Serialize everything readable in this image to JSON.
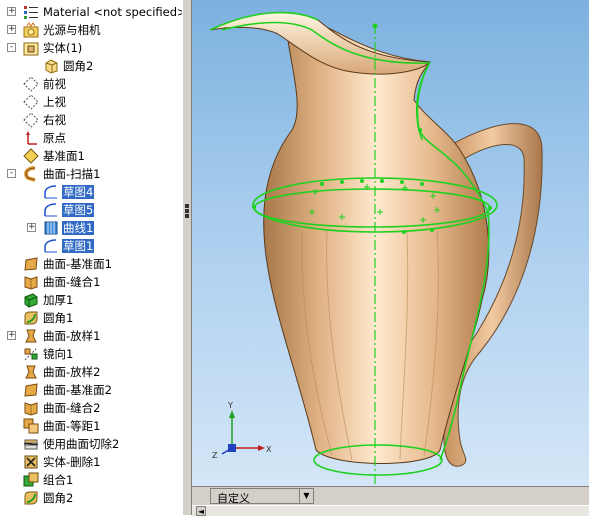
{
  "tree": {
    "items": [
      {
        "label": "Material <not specified>",
        "icon": "material-icon",
        "expander": "+"
      },
      {
        "label": "光源与相机",
        "icon": "lights-camera-icon",
        "expander": "+"
      },
      {
        "label": "实体(1)",
        "icon": "solid-bodies-folder-icon",
        "expander": "-"
      },
      {
        "label": "圆角2",
        "icon": "solid-body-icon"
      },
      {
        "label": "前视",
        "icon": "plane-icon"
      },
      {
        "label": "上视",
        "icon": "plane-icon"
      },
      {
        "label": "右视",
        "icon": "plane-icon"
      },
      {
        "label": "原点",
        "icon": "origin-icon"
      },
      {
        "label": "基准面1",
        "icon": "reference-plane-icon"
      },
      {
        "label": "曲面-扫描1",
        "icon": "surface-sweep-icon",
        "expander": "-"
      },
      {
        "label": "草图4",
        "icon": "sketch-icon",
        "selected": true
      },
      {
        "label": "草图5",
        "icon": "sketch-icon",
        "selected": true
      },
      {
        "label": "曲线1",
        "icon": "curve-icon",
        "selected": true,
        "expander": "+"
      },
      {
        "label": "草图1",
        "icon": "sketch-icon",
        "selected": true
      },
      {
        "label": "曲面-基准面1",
        "icon": "planar-surface-icon"
      },
      {
        "label": "曲面-缝合1",
        "icon": "knit-surface-icon"
      },
      {
        "label": "加厚1",
        "icon": "thicken-icon"
      },
      {
        "label": "圆角1",
        "icon": "fillet-icon"
      },
      {
        "label": "曲面-放样1",
        "icon": "surface-loft-icon",
        "expander": "+"
      },
      {
        "label": "镜向1",
        "icon": "mirror-icon"
      },
      {
        "label": "曲面-放样2",
        "icon": "surface-loft-icon"
      },
      {
        "label": "曲面-基准面2",
        "icon": "planar-surface-icon"
      },
      {
        "label": "曲面-缝合2",
        "icon": "knit-surface-icon"
      },
      {
        "label": "曲面-等距1",
        "icon": "offset-surface-icon"
      },
      {
        "label": "使用曲面切除2",
        "icon": "surface-cut-icon"
      },
      {
        "label": "实体-删除1",
        "icon": "delete-body-icon"
      },
      {
        "label": "组合1",
        "icon": "combine-icon"
      },
      {
        "label": "圆角2",
        "icon": "fillet-icon"
      }
    ]
  },
  "bottombar": {
    "view_selector": "自定义"
  },
  "viewport": {
    "triad": {
      "x": "X",
      "y": "Y",
      "z": "Z"
    }
  },
  "colors": {
    "selection": "#316ac5",
    "sketch_green": "#1fd11f",
    "pitcher_body": "#e6b98c",
    "background_top": "#7cb1df"
  }
}
